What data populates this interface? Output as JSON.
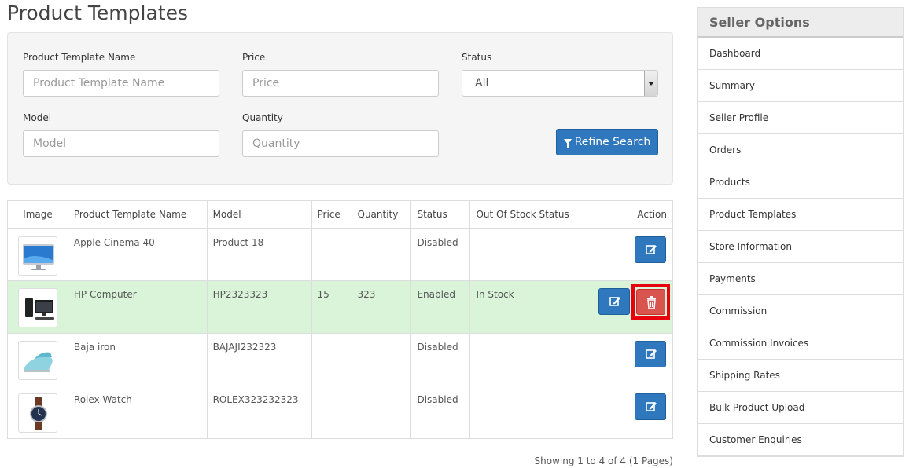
{
  "page": {
    "title": "Product Templates"
  },
  "filters": {
    "name": {
      "label": "Product Template Name",
      "placeholder": "Product Template Name"
    },
    "price": {
      "label": "Price",
      "placeholder": "Price"
    },
    "status": {
      "label": "Status",
      "value": "All"
    },
    "model": {
      "label": "Model",
      "placeholder": "Model"
    },
    "quantity": {
      "label": "Quantity",
      "placeholder": "Quantity"
    },
    "refine_label": "Refine Search"
  },
  "table": {
    "headers": [
      "Image",
      "Product Template Name",
      "Model",
      "Price",
      "Quantity",
      "Status",
      "Out Of Stock Status",
      "Action"
    ],
    "rows": [
      {
        "image": "monitor",
        "name": "Apple Cinema 40",
        "model": "Product 18",
        "price": "",
        "quantity": "",
        "status": "Disabled",
        "stock_status": ""
      },
      {
        "image": "desktop-computer",
        "name": "HP Computer",
        "model": "HP2323323",
        "price": "15",
        "quantity": "323",
        "status": "Enabled",
        "stock_status": "In Stock"
      },
      {
        "image": "steam-iron",
        "name": "Baja iron",
        "model": "BAJAJI232323",
        "price": "",
        "quantity": "",
        "status": "Disabled",
        "stock_status": ""
      },
      {
        "image": "wrist-watch",
        "name": "Rolex Watch",
        "model": "ROLEX323232323",
        "price": "",
        "quantity": "",
        "status": "Disabled",
        "stock_status": ""
      }
    ]
  },
  "pagination": {
    "text": "Showing 1 to 4 of 4 (1 Pages)"
  },
  "sidebar": {
    "heading": "Seller Options",
    "items": [
      {
        "label": "Dashboard"
      },
      {
        "label": "Summary"
      },
      {
        "label": "Seller Profile"
      },
      {
        "label": "Orders"
      },
      {
        "label": "Products"
      },
      {
        "label": "Product Templates"
      },
      {
        "label": "Store Information"
      },
      {
        "label": "Payments"
      },
      {
        "label": "Commission"
      },
      {
        "label": "Commission Invoices"
      },
      {
        "label": "Shipping Rates"
      },
      {
        "label": "Bulk Product Upload"
      },
      {
        "label": "Customer Enquiries"
      }
    ]
  },
  "colors": {
    "primary": "#2f78bd",
    "danger": "#d9534f",
    "highlight": "#e8000e",
    "active_row": "#d9f4d9"
  }
}
